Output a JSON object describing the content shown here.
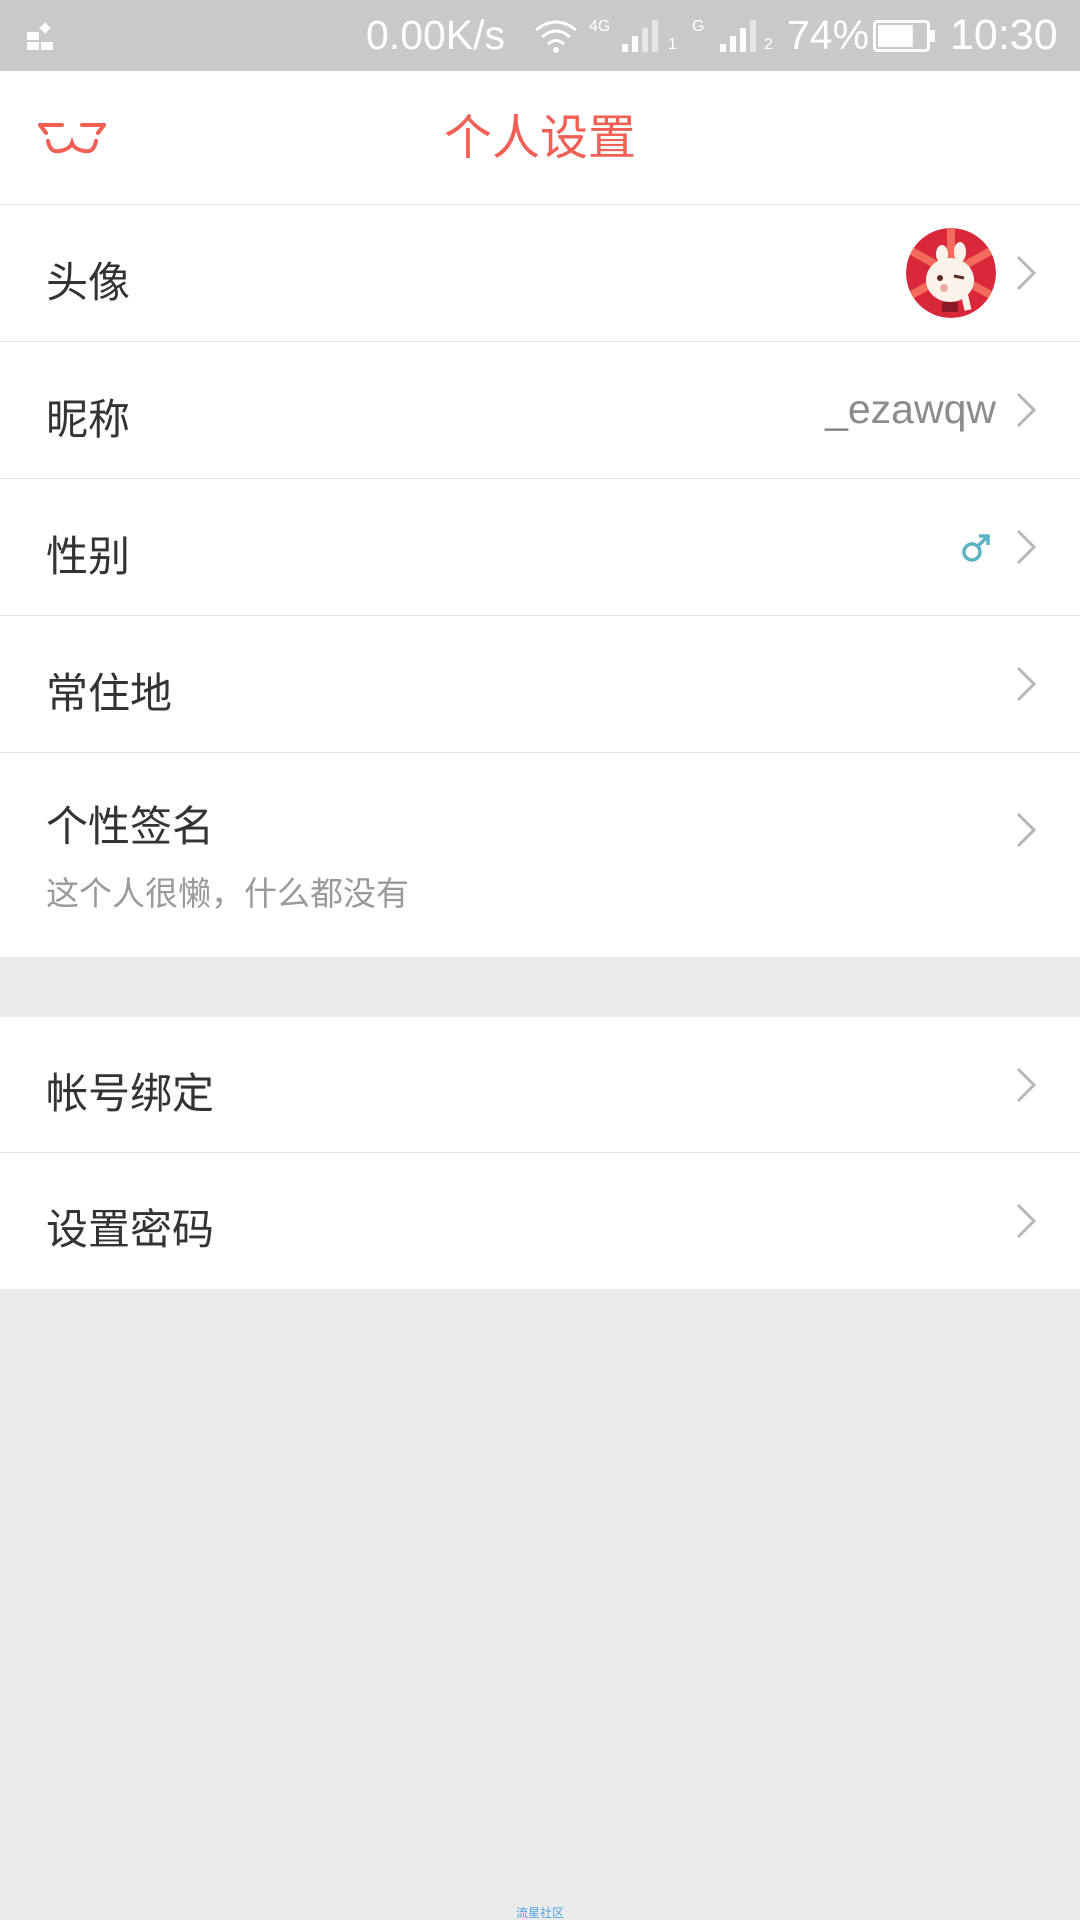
{
  "status_bar": {
    "net_speed": "0.00K/s",
    "net_type_1": "4G",
    "sim_1": "1",
    "net_type_2": "G",
    "sim_2": "2",
    "battery_percent": "74%",
    "battery_level": 0.74,
    "time": "10:30"
  },
  "header": {
    "title": "个人设置",
    "back_icon": "back-face-icon"
  },
  "profile_rows": [
    {
      "label": "头像",
      "value_type": "avatar"
    },
    {
      "label": "昵称",
      "value": "_ezawqw"
    },
    {
      "label": "性别",
      "value_icon": "male-icon",
      "value_color": "#5bb3c5"
    },
    {
      "label": "常住地",
      "value": ""
    },
    {
      "label": "个性签名",
      "sub": "这个人很懒，什么都没有"
    }
  ],
  "account_rows": [
    {
      "label": "帐号绑定"
    },
    {
      "label": "设置密码"
    }
  ],
  "footer": {
    "watermark": "流星社区"
  },
  "colors": {
    "accent": "#f15f55",
    "page_bg": "#ebebeb",
    "status_bar_bg": "#c9c9c9"
  }
}
